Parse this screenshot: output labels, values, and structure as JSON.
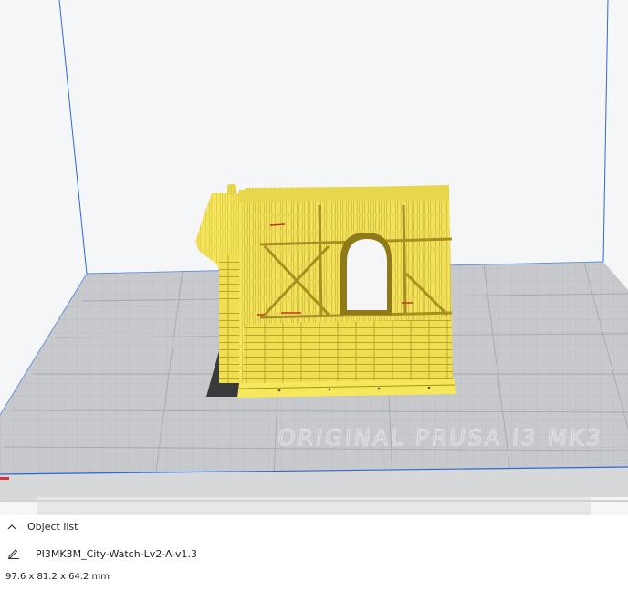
{
  "object_list": {
    "header_label": "Object list",
    "object_name": "PI3MK3M_City-Watch-Lv2-A-v1.3",
    "dimensions": "97.6 x 81.2 x 64.2 mm"
  },
  "viewport": {
    "model_color": "#f5e44a",
    "build_plate_color": "#c9cbce",
    "volume_outline_color": "#2a6ad6",
    "plate_logo_text": "ORIGINAL PRUSA i3 MK3"
  },
  "icons": {
    "collapse": "chevron-up-icon",
    "edit": "pencil-icon"
  }
}
